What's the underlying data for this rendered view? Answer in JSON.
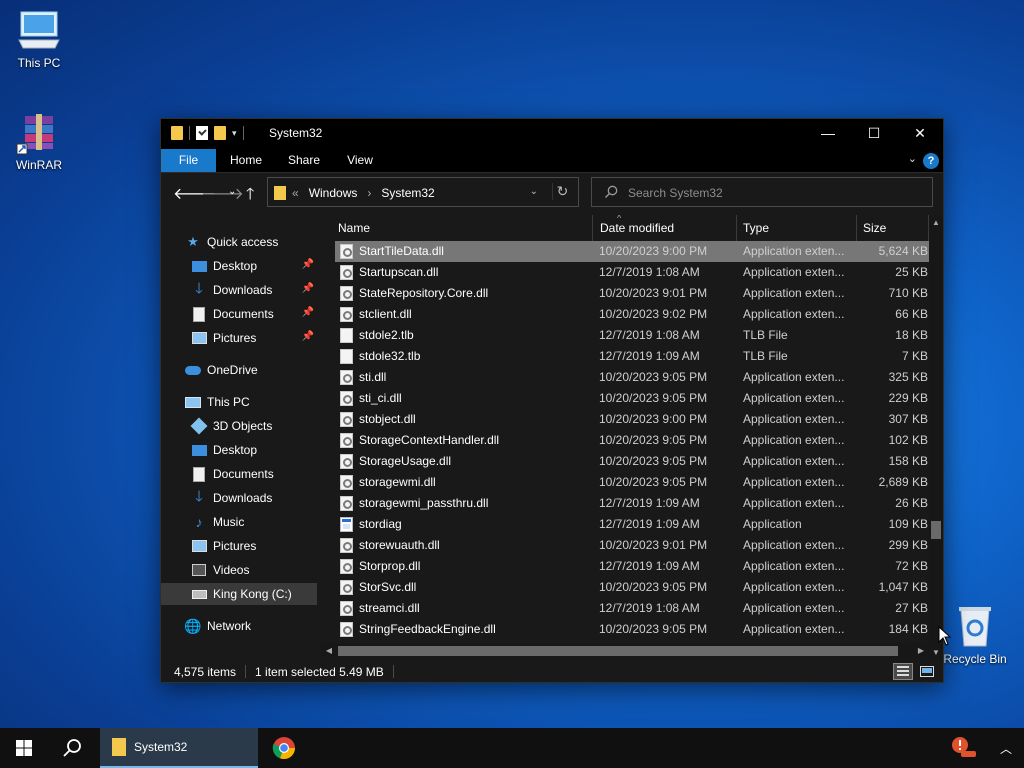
{
  "desktop": {
    "icons": [
      {
        "label": "This PC",
        "icon": "computer-icon"
      },
      {
        "label": "WinRAR",
        "icon": "winrar-books-icon"
      },
      {
        "label": "Recycle Bin",
        "icon": "recycle-bin-icon"
      }
    ]
  },
  "window": {
    "title": "System32",
    "controls": {
      "minimize": "—",
      "maximize": "☐",
      "close": "✕"
    },
    "ribbon": {
      "tabs": [
        "File",
        "Home",
        "Share",
        "View"
      ],
      "help": "?"
    },
    "address": {
      "overflow": "«",
      "crumbs": [
        "Windows",
        "System32"
      ],
      "separator": "›"
    },
    "search": {
      "placeholder": "Search System32"
    },
    "nav": {
      "quick_access": "Quick access",
      "quick_items": [
        "Desktop",
        "Downloads",
        "Documents",
        "Pictures"
      ],
      "onedrive": "OneDrive",
      "this_pc": "This PC",
      "pc_items": [
        "3D Objects",
        "Desktop",
        "Documents",
        "Downloads",
        "Music",
        "Pictures",
        "Videos"
      ],
      "drive": "King Kong  (C:)",
      "network": "Network"
    },
    "columns": {
      "name": "Name",
      "date": "Date modified",
      "type": "Type",
      "size": "Size"
    },
    "files": [
      {
        "name": "StartTileData.dll",
        "date": "10/20/2023 9:00 PM",
        "type": "Application exten...",
        "size": "5,624 KB",
        "icon": "dll",
        "selected": true
      },
      {
        "name": "Startupscan.dll",
        "date": "12/7/2019 1:08 AM",
        "type": "Application exten...",
        "size": "25 KB",
        "icon": "dll"
      },
      {
        "name": "StateRepository.Core.dll",
        "date": "10/20/2023 9:01 PM",
        "type": "Application exten...",
        "size": "710 KB",
        "icon": "dll"
      },
      {
        "name": "stclient.dll",
        "date": "10/20/2023 9:02 PM",
        "type": "Application exten...",
        "size": "66 KB",
        "icon": "dll"
      },
      {
        "name": "stdole2.tlb",
        "date": "12/7/2019 1:08 AM",
        "type": "TLB File",
        "size": "18 KB",
        "icon": "file"
      },
      {
        "name": "stdole32.tlb",
        "date": "12/7/2019 1:09 AM",
        "type": "TLB File",
        "size": "7 KB",
        "icon": "file"
      },
      {
        "name": "sti.dll",
        "date": "10/20/2023 9:05 PM",
        "type": "Application exten...",
        "size": "325 KB",
        "icon": "dll"
      },
      {
        "name": "sti_ci.dll",
        "date": "10/20/2023 9:05 PM",
        "type": "Application exten...",
        "size": "229 KB",
        "icon": "dll"
      },
      {
        "name": "stobject.dll",
        "date": "10/20/2023 9:00 PM",
        "type": "Application exten...",
        "size": "307 KB",
        "icon": "dll"
      },
      {
        "name": "StorageContextHandler.dll",
        "date": "10/20/2023 9:05 PM",
        "type": "Application exten...",
        "size": "102 KB",
        "icon": "dll"
      },
      {
        "name": "StorageUsage.dll",
        "date": "10/20/2023 9:05 PM",
        "type": "Application exten...",
        "size": "158 KB",
        "icon": "dll"
      },
      {
        "name": "storagewmi.dll",
        "date": "10/20/2023 9:05 PM",
        "type": "Application exten...",
        "size": "2,689 KB",
        "icon": "dll"
      },
      {
        "name": "storagewmi_passthru.dll",
        "date": "12/7/2019 1:09 AM",
        "type": "Application exten...",
        "size": "26 KB",
        "icon": "dll"
      },
      {
        "name": "stordiag",
        "date": "12/7/2019 1:09 AM",
        "type": "Application",
        "size": "109 KB",
        "icon": "app"
      },
      {
        "name": "storewuauth.dll",
        "date": "10/20/2023 9:01 PM",
        "type": "Application exten...",
        "size": "299 KB",
        "icon": "dll"
      },
      {
        "name": "Storprop.dll",
        "date": "12/7/2019 1:09 AM",
        "type": "Application exten...",
        "size": "72 KB",
        "icon": "dll"
      },
      {
        "name": "StorSvc.dll",
        "date": "10/20/2023 9:05 PM",
        "type": "Application exten...",
        "size": "1,047 KB",
        "icon": "dll"
      },
      {
        "name": "streamci.dll",
        "date": "12/7/2019 1:08 AM",
        "type": "Application exten...",
        "size": "27 KB",
        "icon": "dll"
      },
      {
        "name": "StringFeedbackEngine.dll",
        "date": "10/20/2023 9:05 PM",
        "type": "Application exten...",
        "size": "184 KB",
        "icon": "dll"
      }
    ],
    "status": {
      "count": "4,575 items",
      "selection": "1 item selected  5.49 MB"
    }
  },
  "taskbar": {
    "open_window": "System32",
    "accent": "#76b9ed"
  }
}
